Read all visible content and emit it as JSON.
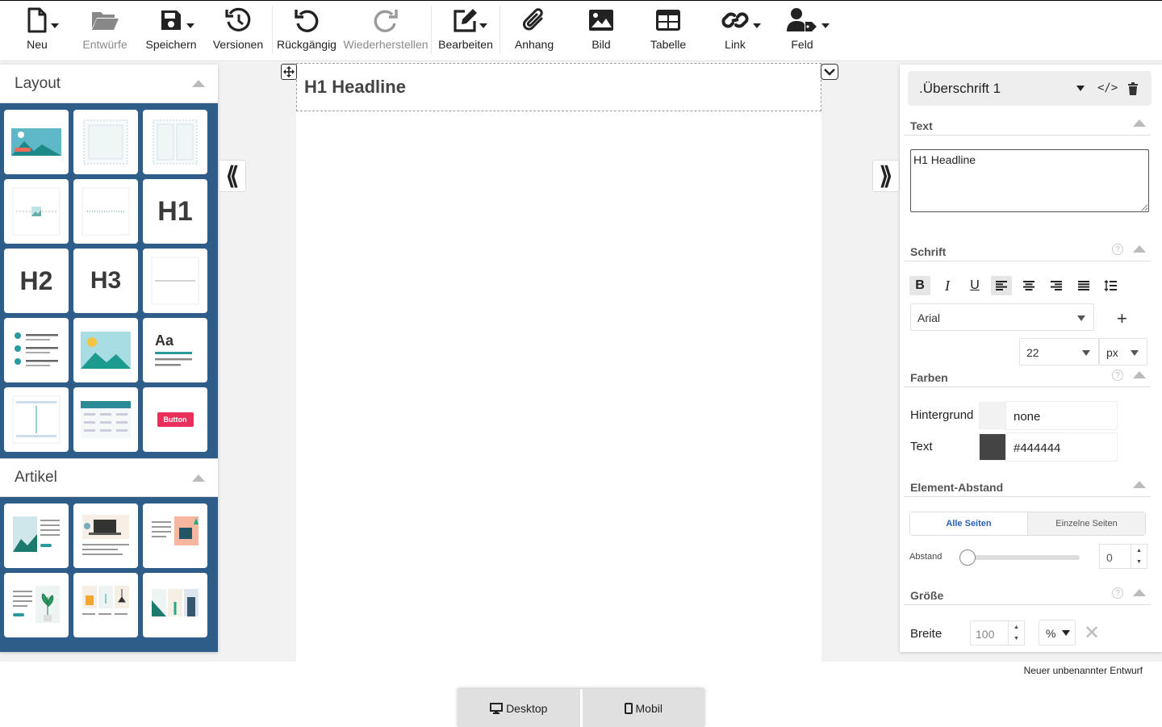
{
  "toolbar": {
    "items": [
      {
        "label": "Neu",
        "icon": "file-icon",
        "dropdown": true
      },
      {
        "label": "Entwürfe",
        "icon": "folder-open-icon",
        "disabled": true
      },
      {
        "label": "Speichern",
        "icon": "save-icon",
        "dropdown": true
      },
      {
        "label": "Versionen",
        "icon": "history-icon"
      },
      {
        "label": "Rückgängig",
        "icon": "undo-icon"
      },
      {
        "label": "Wiederherstellen",
        "icon": "redo-icon",
        "disabled": true
      },
      {
        "label": "Bearbeiten",
        "icon": "edit-icon",
        "dropdown": true
      },
      {
        "label": "Anhang",
        "icon": "paperclip-icon"
      },
      {
        "label": "Bild",
        "icon": "image-icon"
      },
      {
        "label": "Tabelle",
        "icon": "table-icon"
      },
      {
        "label": "Link",
        "icon": "link-icon",
        "dropdown": true
      },
      {
        "label": "Feld",
        "icon": "user-tag-icon",
        "dropdown": true
      }
    ]
  },
  "left_panel": {
    "layout_title": "Layout",
    "layout_tiles": [
      "hero-image",
      "frame",
      "two-columns",
      "image-small",
      "divider-dotted",
      "H1",
      "H2",
      "H3",
      "line",
      "checklist",
      "image",
      "Aa",
      "spacer",
      "table",
      "Button"
    ],
    "article_title": "Artikel"
  },
  "canvas": {
    "headline": "H1 Headline"
  },
  "right_panel": {
    "element_name": ".Überschrift 1",
    "text_section": "Text",
    "text_value": "H1 Headline",
    "font_section": "Schrift",
    "font_family": "Arial",
    "font_size": "22",
    "font_unit": "px",
    "colors_section": "Farben",
    "bg_label": "Hintergrund",
    "bg_value": "none",
    "text_label": "Text",
    "text_color_value": "#444444",
    "text_color": "#444444",
    "spacing_section": "Element-Abstand",
    "all_sides": "Alle Seiten",
    "single_sides": "Einzelne Seiten",
    "spacing_label": "Abstand",
    "spacing_value": "0",
    "size_section": "Größe",
    "width_label": "Breite",
    "width_value": "100",
    "width_unit": "%"
  },
  "footer": {
    "draft_name": "Neuer unbenannter Entwurf",
    "desktop": "Desktop",
    "mobile": "Mobil"
  }
}
